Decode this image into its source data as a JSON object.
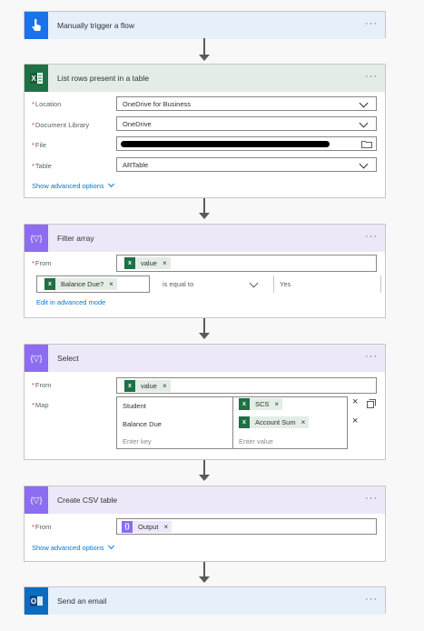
{
  "trigger": {
    "title": "Manually trigger a flow",
    "more": "···"
  },
  "list_rows": {
    "title": "List rows present in a table",
    "more": "···",
    "fields": [
      {
        "label": "Location",
        "value": "OneDrive for Business"
      },
      {
        "label": "Document Library",
        "value": "OneDrive"
      },
      {
        "label": "File",
        "value": ""
      },
      {
        "label": "Table",
        "value": "ARTable"
      }
    ],
    "advanced": "Show advanced options"
  },
  "filter": {
    "title": "Filter array",
    "more": "···",
    "from_label": "From",
    "from_token": "value",
    "cond_token": "Balance Due?",
    "operator": "is equal to",
    "value": "Yes",
    "edit_link": "Edit in advanced mode"
  },
  "select": {
    "title": "Select",
    "more": "···",
    "from_label": "From",
    "from_token": "value",
    "map_label": "Map",
    "rows": [
      {
        "key": "Student",
        "value": "SCS"
      },
      {
        "key": "Balance Due",
        "value": "Account Sum"
      }
    ],
    "key_placeholder": "Enter key",
    "value_placeholder": "Enter value"
  },
  "csv": {
    "title": "Create CSV table",
    "more": "···",
    "from_label": "From",
    "from_token": "Output",
    "advanced": "Show advanced options"
  },
  "email": {
    "title": "Send an email",
    "more": "···"
  },
  "colors": {
    "trigger": "#1a73e8",
    "excel": "#1e7145",
    "operation": "#8c6cf0",
    "outlook": "#0f6cbd",
    "link": "#0078d4"
  }
}
